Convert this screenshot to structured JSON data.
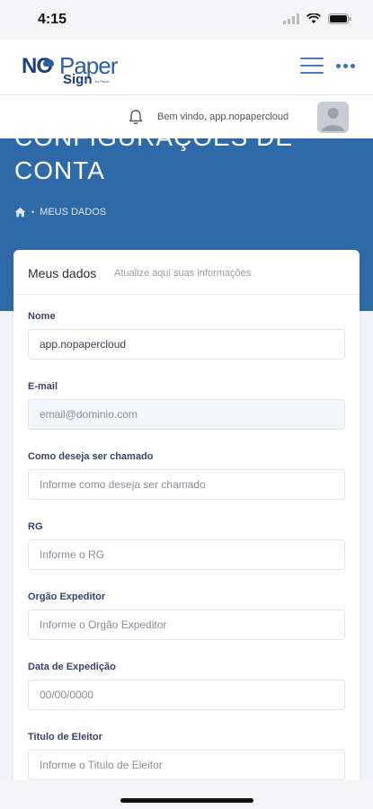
{
  "status": {
    "time": "4:15"
  },
  "brand": {
    "no": "NO",
    "paper": "Paper",
    "sign": "Sign",
    "by": "by Paper"
  },
  "header": {
    "welcome": "Bem vindo, app.nopapercloud"
  },
  "banner": {
    "title_line1": "CONFIGURAÇÕES DE",
    "title_line2": "CONTA",
    "breadcrumb": "MEUS DADOS"
  },
  "card": {
    "title": "Meus dados",
    "subtitle": "Atualize aqui suas informações",
    "fields": [
      {
        "label": "Nome",
        "value": "app.nopapercloud",
        "placeholder": ""
      },
      {
        "label": "E-mail",
        "value": "",
        "placeholder": "email@dominio.com"
      },
      {
        "label": "Como deseja ser chamado",
        "value": "",
        "placeholder": "Informe como deseja ser chamado"
      },
      {
        "label": "RG",
        "value": "",
        "placeholder": "Informe o RG"
      },
      {
        "label": "Orgão Expeditor",
        "value": "",
        "placeholder": "Informe o Orgão Expeditor"
      },
      {
        "label": "Data de Expedição",
        "value": "",
        "placeholder": "00/00/0000"
      },
      {
        "label": "Titulo de Eleitor",
        "value": "",
        "placeholder": "Informe o Titulo de Eleitor"
      }
    ]
  },
  "colors": {
    "banner": "#2f6aa8",
    "accent": "#3b6fc4",
    "label": "#3a4370"
  }
}
